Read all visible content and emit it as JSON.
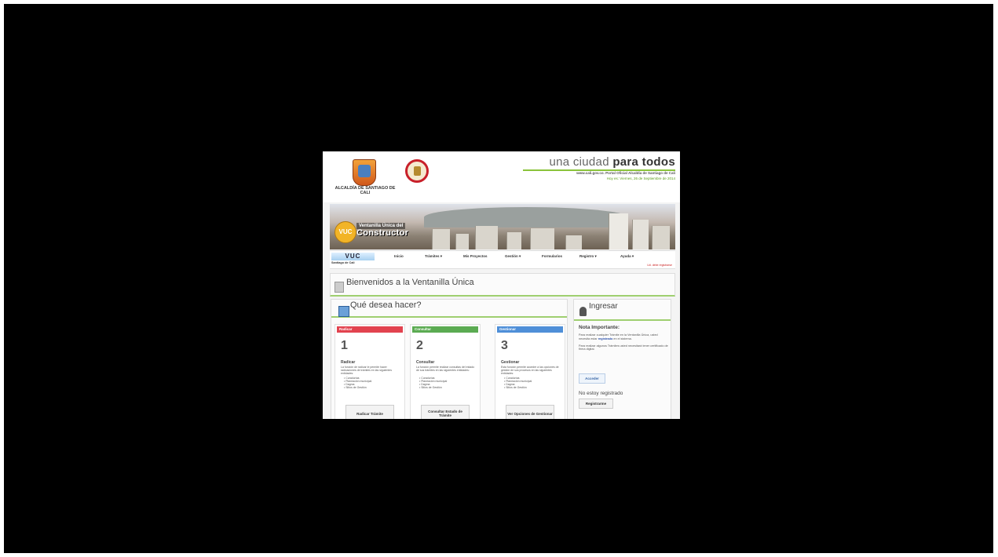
{
  "header": {
    "alcaldia_name": "ALCALDÍA DE SANTIAGO DE CALI",
    "slogan_light": "una ciudad",
    "slogan_bold": "para todos",
    "portal_line": "www.cali.gov.co. Portal Oficial Alcaldía de Santiago de Cali",
    "date_line": "Hoy es: Viernes, 26 de Septiembre de 2014"
  },
  "banner": {
    "logo_short": "VUC",
    "logo_text_top": "Ventanilla Única del",
    "logo_text_main": "Constructor"
  },
  "nav": {
    "brand": "VUC",
    "brand_sub": "Santiago de Cali",
    "items": [
      "Inicio",
      "Trámites ▾",
      "Mis Proyectos",
      "Gestión ▾",
      "Formularios",
      "Registro ▾",
      "Ayuda ▾"
    ],
    "note": "Ud. debe registrarse"
  },
  "welcome": {
    "title": "Bienvenidos a la Ventanilla Única"
  },
  "main": {
    "title": "Qué desea hacer?",
    "cards": [
      {
        "bar": "Radicar",
        "number": "1",
        "heading": "Radicar",
        "desc": "La función de radicar le permite hacer radicaciones de trámites en las siguientes entidades:",
        "list": [
          "• Curadurías",
          "• Planeación municipal",
          "• Dagma",
          "• Sitios de Gestión"
        ],
        "button": "Radicar Trámite",
        "color": "#e2434f"
      },
      {
        "bar": "Consultar",
        "number": "2",
        "heading": "Consultar",
        "desc": "La función permite realizar consultas del estado de sus trámites en las siguientes entidades:",
        "list": [
          "• Curadurías",
          "• Planeación municipal",
          "• Dagma",
          "• Sitios de Gestión"
        ],
        "button": "Consultar Estado de Trámite",
        "color": "#5bab52"
      },
      {
        "bar": "Gestionar",
        "number": "3",
        "heading": "Gestionar",
        "desc": "Esta función permite acceder a las opciones de gestión de sus procesos en las siguientes entidades:",
        "list": [
          "• Curadurías",
          "• Planeación municipal",
          "• Dagma",
          "• Sitios de Gestión"
        ],
        "button": "Ver Opciones de Gestionar",
        "color": "#4f8fd8"
      }
    ]
  },
  "side": {
    "title": "Ingresar",
    "note_title": "Nota Importante:",
    "note_p1_a": "Para realizar cualquier Trámite en la Ventanilla Única, usted necesita estar",
    "note_p1_link": "registrado",
    "note_p1_b": "en el sistema.",
    "note_p2": "Para realizar algunos Trámites usted necesitará tener certificado de firma digital.",
    "access_button": "Acceder",
    "no_reg": "No estoy registrado",
    "register_button": "Registrarme"
  }
}
